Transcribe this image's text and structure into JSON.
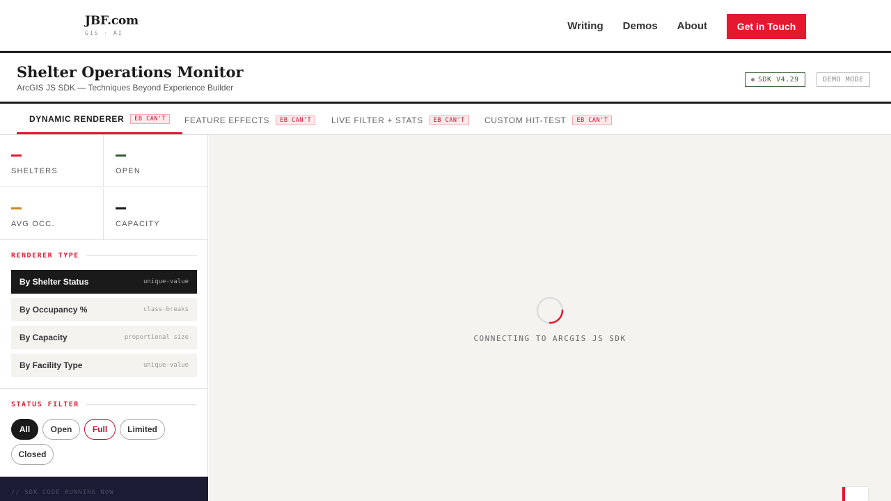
{
  "nav": {
    "logo_main": "JBF.com",
    "logo_sub": "GIS · AI",
    "links": [
      "Writing",
      "Demos",
      "About"
    ],
    "cta": "Get in Touch"
  },
  "header": {
    "title": "Shelter Operations Monitor",
    "subtitle": "ArcGIS JS SDK — Techniques Beyond Experience Builder",
    "sdk_badge": "SDK V4.29",
    "demo_badge": "DEMO MODE"
  },
  "tabs": [
    {
      "label": "DYNAMIC RENDERER",
      "tag": "EB CAN'T",
      "active": true
    },
    {
      "label": "FEATURE EFFECTS",
      "tag": "EB CAN'T",
      "active": false
    },
    {
      "label": "LIVE FILTER + STATS",
      "tag": "EB CAN'T",
      "active": false
    },
    {
      "label": "CUSTOM HIT-TEST",
      "tag": "EB CAN'T",
      "active": false
    }
  ],
  "stats": [
    {
      "label": "SHELTERS",
      "color": "#e4182f"
    },
    {
      "label": "OPEN",
      "color": "#2f5d2f"
    },
    {
      "label": "AVG OCC.",
      "color": "#c98a1c"
    },
    {
      "label": "CAPACITY",
      "color": "#1a1a1a"
    }
  ],
  "renderer": {
    "section_title": "RENDERER TYPE",
    "options": [
      {
        "label": "By Shelter Status",
        "type": "unique-value",
        "active": true
      },
      {
        "label": "By Occupancy %",
        "type": "class-breaks",
        "active": false
      },
      {
        "label": "By Capacity",
        "type": "proportional size",
        "active": false
      },
      {
        "label": "By Facility Type",
        "type": "unique-value",
        "active": false
      }
    ]
  },
  "filter": {
    "section_title": "STATUS FILTER",
    "chips": [
      "All",
      "Open",
      "Full",
      "Limited",
      "Closed"
    ]
  },
  "code": {
    "comment": "// SDK CODE RUNNING NOW"
  },
  "map": {
    "loading_text": "CONNECTING TO ARCGIS JS SDK"
  },
  "colors": {
    "accent": "#e4182f",
    "dark": "#1a1a1a",
    "map_bg": "#f4f3f0",
    "code_bg": "#1b1b33"
  }
}
